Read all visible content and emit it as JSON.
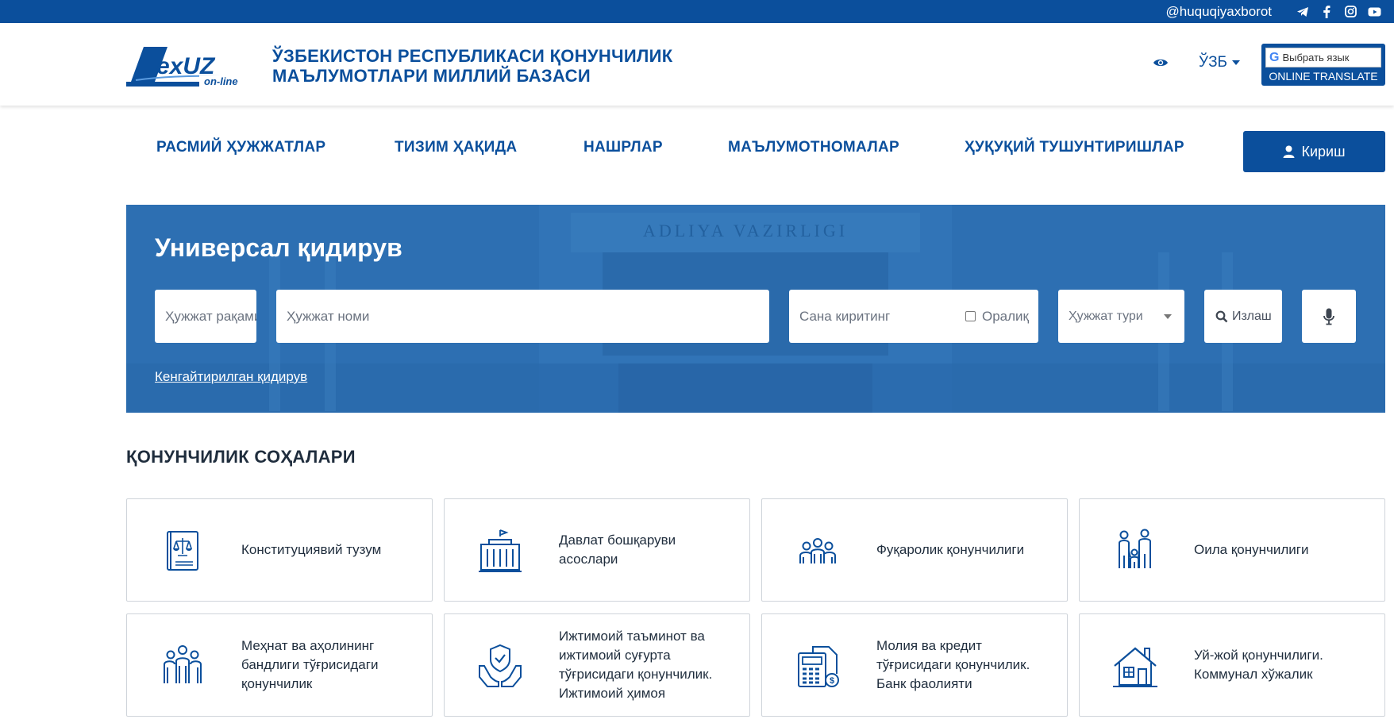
{
  "topbar": {
    "handle": "@huquqiyaxborot",
    "social_icons": [
      "telegram-icon",
      "facebook-icon",
      "instagram-icon",
      "youtube-icon"
    ]
  },
  "header": {
    "logo_text": "LexUZ",
    "logo_sub": "on-line",
    "title_line1": "ЎЗБЕКИСТОН РЕСПУБЛИКАСИ ҚОНУНЧИЛИК",
    "title_line2": "МАЪЛУМОТЛАРИ МИЛЛИЙ БАЗАСИ",
    "language": "ЎЗБ",
    "translate_select": "Выбрать язык",
    "translate_label": "ONLINE TRANSLATE"
  },
  "nav": {
    "items": [
      {
        "label": "РАСМИЙ ҲУЖЖАТЛАР"
      },
      {
        "label": "ТИЗИМ ҲАҚИДА"
      },
      {
        "label": "НАШРЛАР"
      },
      {
        "label": "МАЪЛУМОТНОМАЛАР"
      },
      {
        "label": "ҲУҚУҚИЙ ТУШУНТИРИШЛАР"
      }
    ],
    "login_label": "Кириш"
  },
  "search": {
    "title": "Универсал қидирув",
    "building_text": "ADLIYA VAZIRLIGI",
    "doc_number_placeholder": "Ҳужжат рақами",
    "doc_name_placeholder": "Ҳужжат номи",
    "date_placeholder": "Сана киритинг",
    "range_label": "Оралиқ",
    "doc_type_label": "Ҳужжат тури",
    "search_button": "Излаш",
    "advanced_link": "Кенгайтирилган қидирув"
  },
  "sections": {
    "title": "ҚОНУНЧИЛИК СОҲАЛАРИ",
    "items": [
      {
        "label": "Конституциявий тузум",
        "icon": "constitution-book-icon"
      },
      {
        "label": "Давлат бошқаруви асослари",
        "icon": "government-building-icon"
      },
      {
        "label": "Фуқаролик қонунчилиги",
        "icon": "citizens-group-icon"
      },
      {
        "label": "Оила қонунчилиги",
        "icon": "family-icon"
      },
      {
        "label": "Меҳнат ва аҳолининг бандлиги тўғрисидаги қонунчилик",
        "icon": "workers-icon"
      },
      {
        "label": "Ижтимоий таъминот ва ижтимоий суғурта тўғрисидаги қонунчилик. Ижтимоий ҳимоя",
        "icon": "social-protection-icon"
      },
      {
        "label": "Молия ва кредит тўғрисидаги қонунчилик. Банк фаолияти",
        "icon": "finance-calculator-icon"
      },
      {
        "label": "Уй-жой қонунчилиги. Коммунал хўжалик",
        "icon": "housing-icon"
      }
    ]
  },
  "colors": {
    "brand": "#0b4f9c",
    "hero": "#2e73b6",
    "text": "#1f2d3d"
  }
}
